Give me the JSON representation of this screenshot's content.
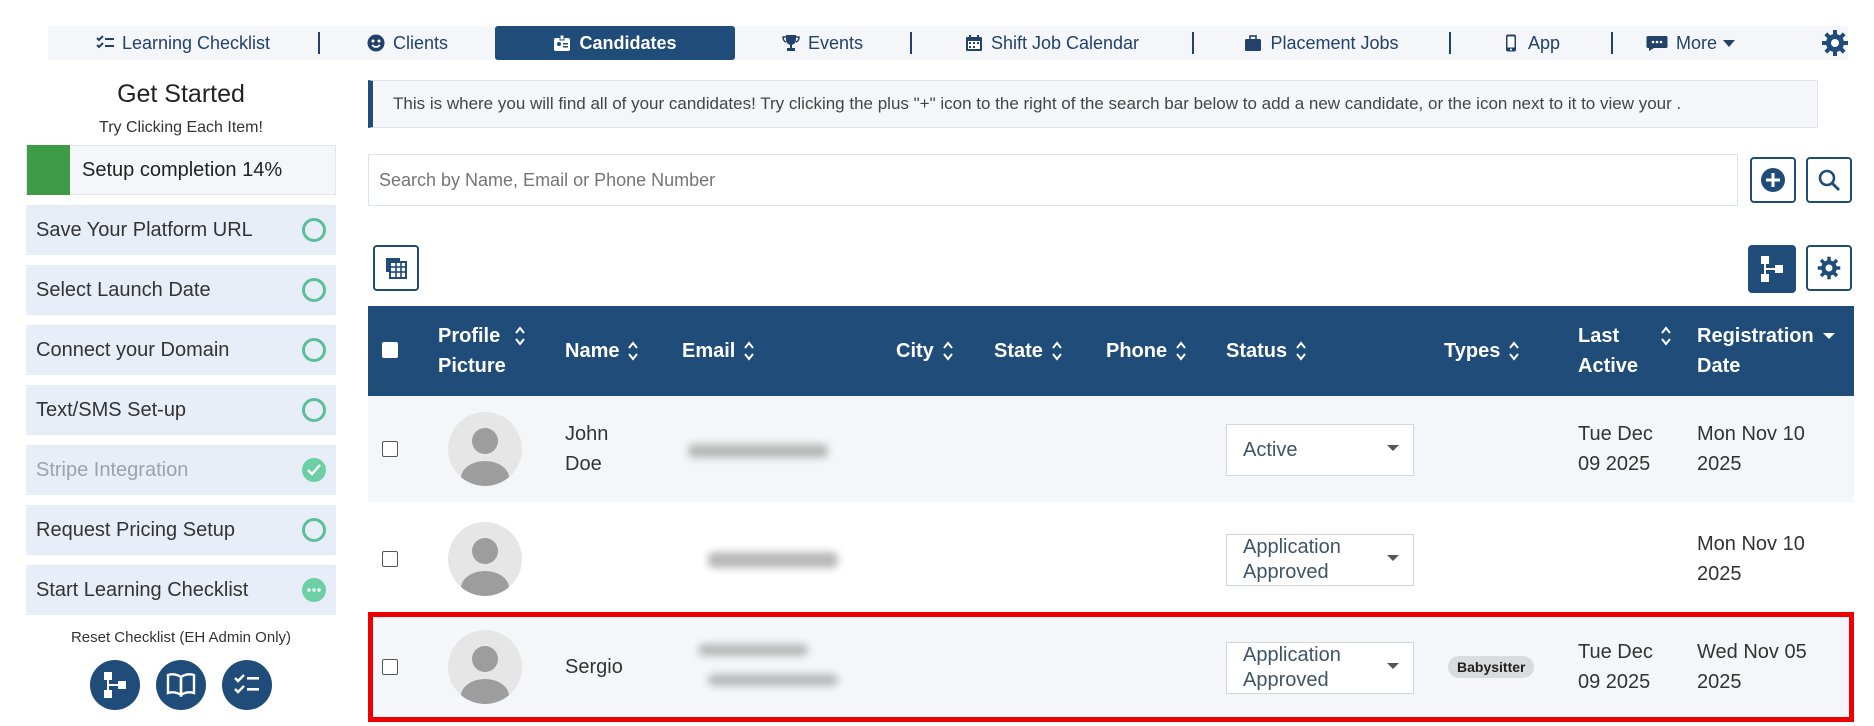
{
  "nav": {
    "items": [
      {
        "label": "Learning Checklist"
      },
      {
        "label": "Clients"
      },
      {
        "label": "Candidates"
      },
      {
        "label": "Events"
      },
      {
        "label": "Shift Job Calendar"
      },
      {
        "label": "Placement Jobs"
      },
      {
        "label": "App"
      },
      {
        "label": "More"
      }
    ]
  },
  "sidebar": {
    "title": "Get Started",
    "subtitle": "Try Clicking Each Item!",
    "progress_label": "Setup completion 14%",
    "progress_value": 0.14,
    "items": [
      {
        "label": "Save Your Platform URL"
      },
      {
        "label": "Select Launch Date"
      },
      {
        "label": "Connect your Domain"
      },
      {
        "label": "Text/SMS Set-up"
      },
      {
        "label": "Stripe Integration"
      },
      {
        "label": "Request Pricing Setup"
      },
      {
        "label": "Start Learning Checklist"
      }
    ],
    "reset_label": "Reset Checklist (EH Admin Only)"
  },
  "main": {
    "info_text": "This is where you will find all of your candidates! Try clicking the plus \"+\" icon to the right of the search bar below to add a new candidate, or the icon next to it to view your .",
    "search_placeholder": "Search by Name, Email or Phone Number"
  },
  "table": {
    "headers": {
      "profile1": "Profile",
      "profile2": "Picture",
      "name": "Name",
      "email": "Email",
      "city": "City",
      "state": "State",
      "phone": "Phone",
      "status": "Status",
      "types": "Types",
      "last1": "Last",
      "last2": "Active",
      "reg1": "Registration",
      "reg2": "Date"
    },
    "rows": [
      {
        "name1": "John",
        "name2": "Doe",
        "status": "Active",
        "type": "",
        "last1": "Tue Dec",
        "last2": "09 2025",
        "reg1": "Mon Nov 10",
        "reg2": "2025"
      },
      {
        "name1": "",
        "name2": "",
        "status1": "Application",
        "status2": "Approved",
        "type": "",
        "last1": "",
        "last2": "",
        "reg1": "Mon Nov 10",
        "reg2": "2025"
      },
      {
        "name1": "Sergio",
        "name2": "",
        "status1": "Application",
        "status2": "Approved",
        "type": "Babysitter",
        "last1": "Tue Dec",
        "last2": "09 2025",
        "reg1": "Wed Nov 05",
        "reg2": "2025"
      }
    ]
  },
  "colors": {
    "primary": "#1f4c78",
    "progress": "#3e9b47",
    "highlight": "#ee0000"
  }
}
